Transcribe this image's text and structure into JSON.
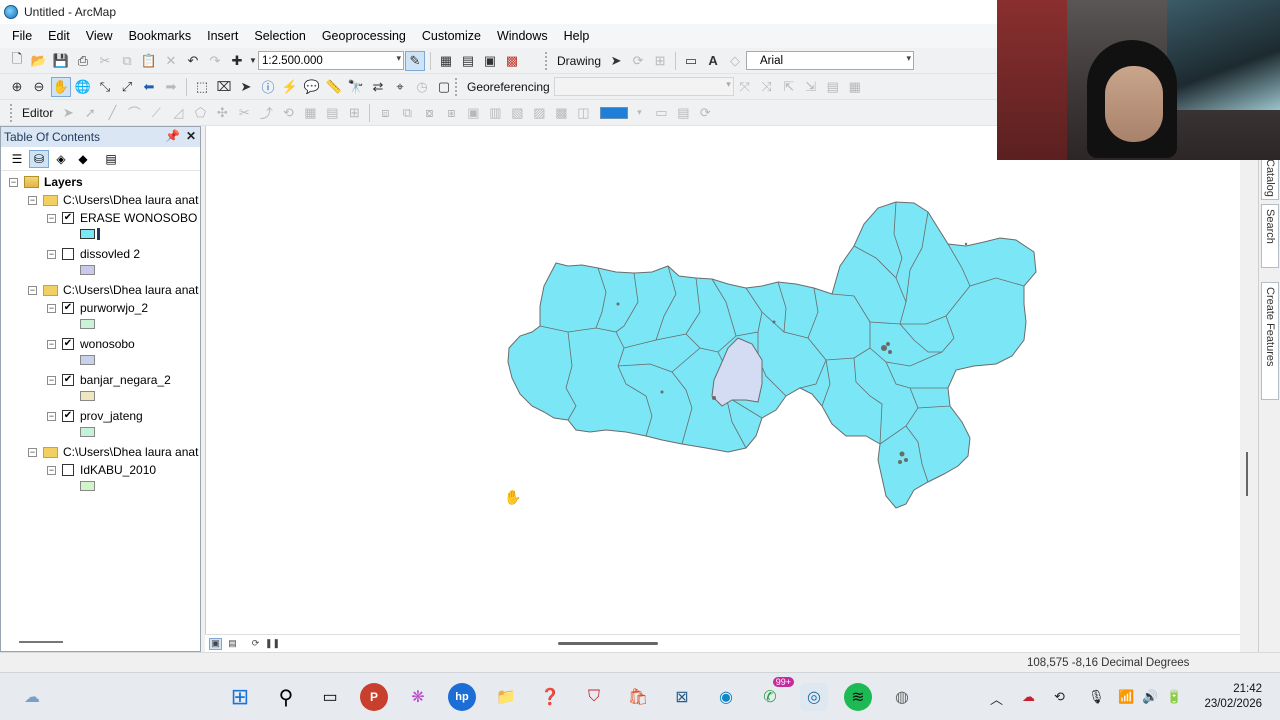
{
  "window": {
    "title": "Untitled - ArcMap"
  },
  "menu": [
    "File",
    "Edit",
    "View",
    "Bookmarks",
    "Insert",
    "Selection",
    "Geoprocessing",
    "Customize",
    "Windows",
    "Help"
  ],
  "toolbar": {
    "scale": "1:2.500.000",
    "drawing_label": "Drawing",
    "font_name": "Arial",
    "georeferencing_label": "Georeferencing",
    "editor_label": "Editor",
    "color_accent": "#1e7fd8"
  },
  "toc": {
    "title": "Table Of Contents",
    "root": "Layers",
    "groups": [
      {
        "path": "C:\\Users\\Dhea laura anat",
        "layers": [
          {
            "name": "ERASE WONOSOBO",
            "checked": true,
            "color": "#7be6f5"
          },
          {
            "name": "dissovled 2",
            "checked": false,
            "color": "#c9c9ea"
          }
        ]
      },
      {
        "path": "C:\\Users\\Dhea laura anat",
        "layers": [
          {
            "name": "purworwjo_2",
            "checked": true,
            "color": "#c9f2d6"
          },
          {
            "name": "wonosobo",
            "checked": true,
            "color": "#c9d1ec"
          },
          {
            "name": "banjar_negara_2",
            "checked": true,
            "color": "#efe6c0"
          },
          {
            "name": "prov_jateng",
            "checked": true,
            "color": "#c5f0d9"
          }
        ]
      },
      {
        "path": "C:\\Users\\Dhea laura anat",
        "layers": [
          {
            "name": "IdKABU_2010",
            "checked": false,
            "color": "#d3f3c8"
          }
        ]
      }
    ]
  },
  "map": {
    "fill_color": "#7be6f5",
    "highlight_color": "#d3dcf3",
    "stroke_color": "#6b6b6b"
  },
  "side_tabs": [
    "Catalog",
    "Search",
    "Create Features"
  ],
  "status": {
    "coords": "108,575  -8,16 Decimal Degrees"
  },
  "taskbar": {
    "badge": "99+",
    "time": "21:42",
    "date": "23/02/2026"
  }
}
